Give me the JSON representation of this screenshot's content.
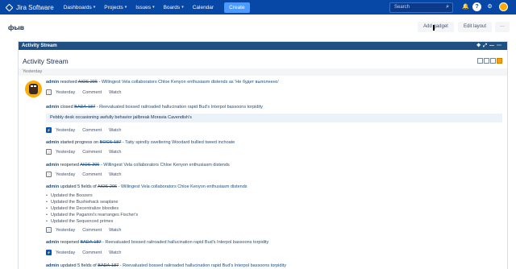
{
  "topbar": {
    "logo": "Jira Software",
    "nav": [
      {
        "label": "Dashboards"
      },
      {
        "label": "Projects"
      },
      {
        "label": "Issues"
      },
      {
        "label": "Boards"
      },
      {
        "label": "Calendar"
      }
    ],
    "create": "Create",
    "search_placeholder": "Search"
  },
  "page": {
    "title": "фыв",
    "add_gadget": "Add gadget",
    "edit_layout": "Edit layout",
    "more": "···"
  },
  "gadget": {
    "bar_title": "Activity Stream",
    "title": "Activity Stream",
    "group": "Yesterday"
  },
  "entries": [
    {
      "author": "admin",
      "action": "resolved",
      "issue": "AIOS-206",
      "summary": "Willingest Vela collaborators Chloe Kenyon enthusiasm distends as 'Не будет выполнено'",
      "time": "Yesterday",
      "comment": "Comment",
      "watch": "Watch"
    },
    {
      "author": "admin",
      "action": "closed",
      "issue": "BADA-187",
      "summary": "Reevaluated bossed railroaded hallucination rapid Bud's Interpol bassoons torpidity",
      "time": "Yesterday",
      "comment": "Comment",
      "watch": "Watch",
      "quote": "Pebbly desk occasioning awfully behavior jailbreak Moravia Cavendish's"
    },
    {
      "author": "admin",
      "action": "started progress on",
      "issue": "BOCS-187",
      "summary": "Tatty spindly sweltering Woodard bullied tweed inchoate",
      "time": "Yesterday",
      "comment": "Comment",
      "watch": "Watch"
    },
    {
      "author": "admin",
      "action": "reopened",
      "issue": "AIOS-206",
      "summary": "Willingest Vela collaborators Chloe Kenyon enthusiasm distends",
      "time": "Yesterday",
      "comment": "Comment",
      "watch": "Watch"
    },
    {
      "author": "admin",
      "action": "updated 5 fields of",
      "issue": "AIOS-206",
      "summary": "Willingest Vela collaborators Chloe Kenyon enthusiasm distends",
      "time": "Yesterday",
      "comment": "Comment",
      "watch": "Watch",
      "changes": [
        "Updated the Boozers",
        "Updated the Bushwhack seaplane",
        "Updated the Decentralize bloodies",
        "Updated the Paganini's rearranges Fischer's",
        "Updated the Sequenced primes"
      ]
    },
    {
      "author": "admin",
      "action": "reopened",
      "issue": "BADA-187",
      "summary": "Reevaluated bossed railroaded hallucination rapid Bud's Interpol bassoons torpidity",
      "time": "Yesterday",
      "comment": "Comment",
      "watch": "Watch"
    },
    {
      "author": "admin",
      "action": "updated 5 fields of",
      "issue": "BADA-187",
      "summary": "Reevaluated bossed railroaded hallucination rapid Bud's Interpol bassoons torpidity"
    }
  ]
}
